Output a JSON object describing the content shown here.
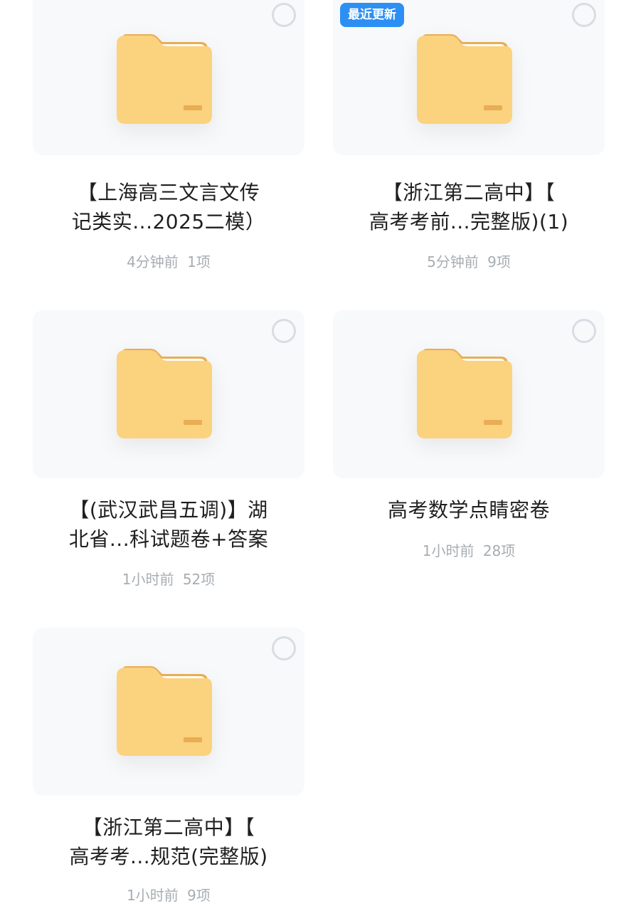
{
  "folders": [
    {
      "title_line1": "【上海高三文言文传",
      "title_line2": "记类实...2025二模）",
      "time": "4分钟前",
      "count": "1项",
      "badge": "",
      "icon": "folder-icon",
      "select_icon": "select-circle-icon"
    },
    {
      "title_line1": "【浙江第二高中】【",
      "title_line2": "高考考前...完整版)(1)",
      "time": "5分钟前",
      "count": "9项",
      "badge": "最近更新",
      "icon": "folder-icon",
      "select_icon": "select-circle-icon"
    },
    {
      "title_line1": "【(武汉武昌五调)】湖",
      "title_line2": "北省...科试题卷+答案",
      "time": "1小时前",
      "count": "52项",
      "badge": "",
      "icon": "folder-icon",
      "select_icon": "select-circle-icon"
    },
    {
      "title_line1": "高考数学点睛密卷",
      "title_line2": "",
      "time": "1小时前",
      "count": "28项",
      "badge": "",
      "icon": "folder-icon",
      "select_icon": "select-circle-icon"
    },
    {
      "title_line1": "【浙江第二高中】【",
      "title_line2": "高考考...规范(完整版)",
      "time": "1小时前",
      "count": "9项",
      "badge": "",
      "icon": "folder-icon",
      "select_icon": "select-circle-icon"
    }
  ],
  "colors": {
    "badge": "#2c8ff3",
    "folder_body": "#fbd27d",
    "folder_back": "#e9ad56",
    "folder_paper": "#fffdf7",
    "title_text": "#1f1f1f",
    "meta_text": "#a7adb3"
  }
}
